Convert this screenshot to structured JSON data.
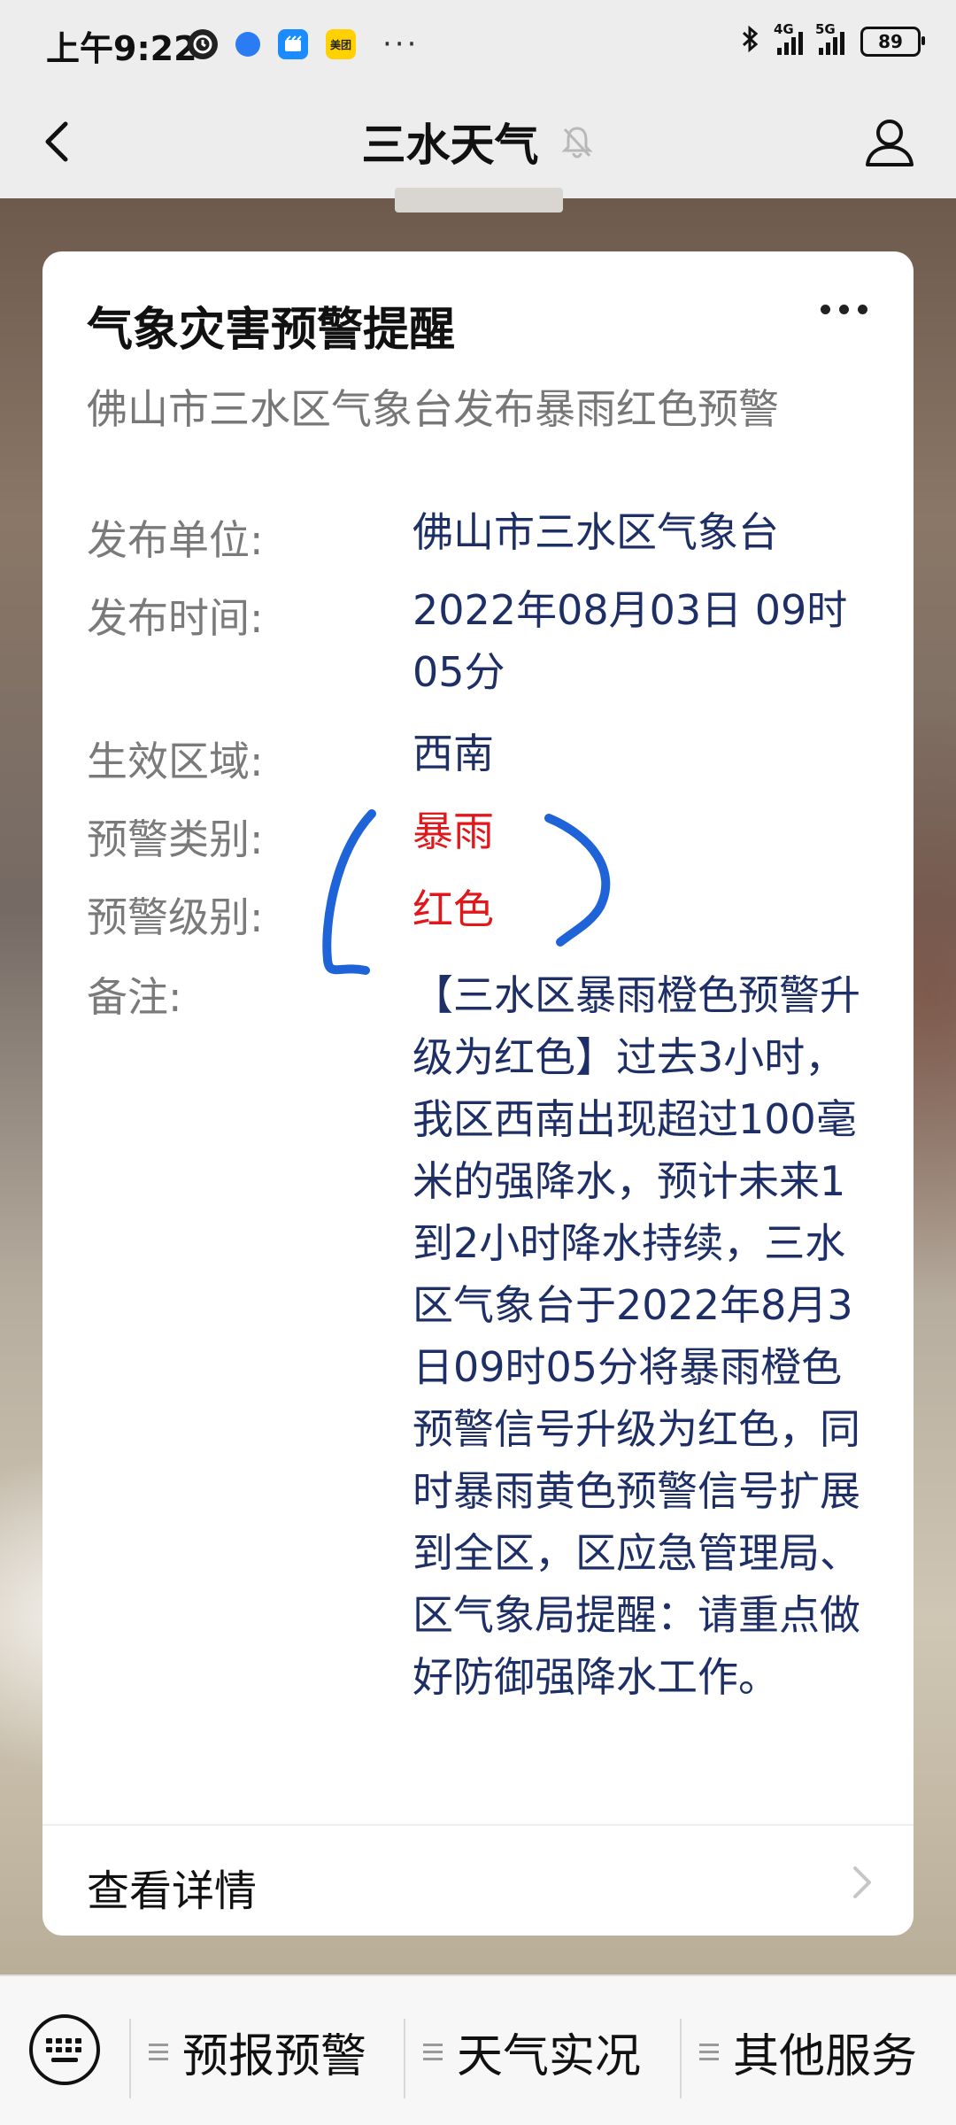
{
  "status_bar": {
    "time": "上午9:22",
    "meituan_label": "美团",
    "net_4g": "4G",
    "net_5g": "5G",
    "battery": "89"
  },
  "nav": {
    "title": "三水天气"
  },
  "card": {
    "title": "气象灾害预警提醒",
    "subtitle": "佛山市三水区气象台发布暴雨红色预警",
    "fields": [
      {
        "label": "发布单位:",
        "value": "佛山市三水区气象台"
      },
      {
        "label": "发布时间:",
        "value": "2022年08月03日 09时05分"
      },
      {
        "label": "生效区域:",
        "value": "西南"
      },
      {
        "label": "预警类别:",
        "value": "暴雨"
      },
      {
        "label": "预警级别:",
        "value": "红色"
      },
      {
        "label": "备注:",
        "value": "【三水区暴雨橙色预警升级为红色】过去3小时，我区西南出现超过100毫米的强降水，预计未来1到2小时降水持续，三水区气象台于2022年8月3日09时05分将暴雨橙色预警信号升级为红色，同时暴雨黄色预警信号扩展到全区，区应急管理局、区气象局提醒：请重点做好防御强降水工作。"
      }
    ],
    "details_label": "查看详情",
    "highlight_color": "#e0171b",
    "value_color": "#1d2f66"
  },
  "bottom_menu": {
    "items": [
      {
        "label": "预报预警"
      },
      {
        "label": "天气实况"
      },
      {
        "label": "其他服务"
      }
    ]
  }
}
